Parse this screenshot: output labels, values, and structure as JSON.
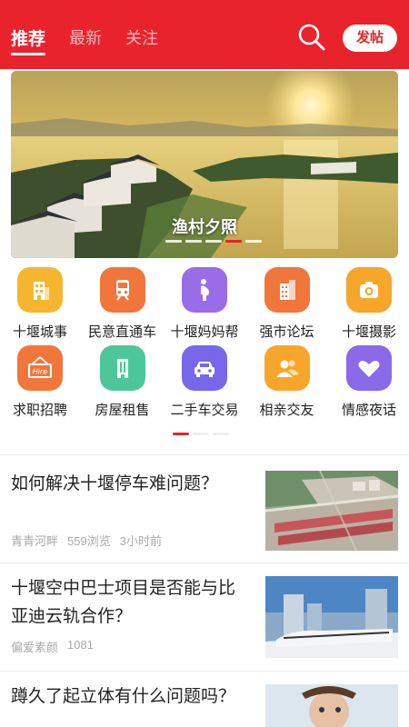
{
  "header": {
    "tabs": [
      {
        "label": "推荐",
        "active": true
      },
      {
        "label": "最新",
        "active": false
      },
      {
        "label": "关注",
        "active": false
      }
    ],
    "search_icon": "search-icon",
    "post_label": "发帖",
    "accent_color": "#e8232b"
  },
  "banner": {
    "caption": "渔村夕照",
    "slide_count": 5,
    "active_slide": 4
  },
  "categories": [
    {
      "label": "十堰城事",
      "icon": "city-building-icon",
      "color": "#f6b52f"
    },
    {
      "label": "民意直通车",
      "icon": "train-icon",
      "color": "#f0763b"
    },
    {
      "label": "十堰妈妈帮",
      "icon": "pregnant-mother-icon",
      "color": "#9b6ce8"
    },
    {
      "label": "强市论坛",
      "icon": "office-building-icon",
      "color": "#f0763b"
    },
    {
      "label": "十堰摄影",
      "icon": "camera-icon",
      "color": "#f6a62a"
    },
    {
      "label": "求职招聘",
      "icon": "hire-sign-icon",
      "color": "#f0763b"
    },
    {
      "label": "房屋租售",
      "icon": "house-building-icon",
      "color": "#4cc79a"
    },
    {
      "label": "二手车交易",
      "icon": "car-icon",
      "color": "#7867e8"
    },
    {
      "label": "相亲交友",
      "icon": "friends-icon",
      "color": "#f6a62a"
    },
    {
      "label": "情感夜话",
      "icon": "heart-icon",
      "color": "#8a6ae8"
    }
  ],
  "grid_pages": {
    "count": 3,
    "active": 1
  },
  "feed": [
    {
      "title": "如何解决十堰停车难问题？",
      "author": "青青河畔",
      "views": "559浏览",
      "time": "3小时前",
      "thumb": "aerial-parking-lot-image"
    },
    {
      "title": "十堰空中巴士项目是否能与比亚迪云轨合作？",
      "author": "偏爱素颜",
      "views": "1081",
      "time": "",
      "thumb": "monorail-train-image"
    },
    {
      "title": "蹲久了起立体有什么问题吗？",
      "author": "",
      "views": "",
      "time": "",
      "thumb": "cartoon-figure-image"
    }
  ]
}
